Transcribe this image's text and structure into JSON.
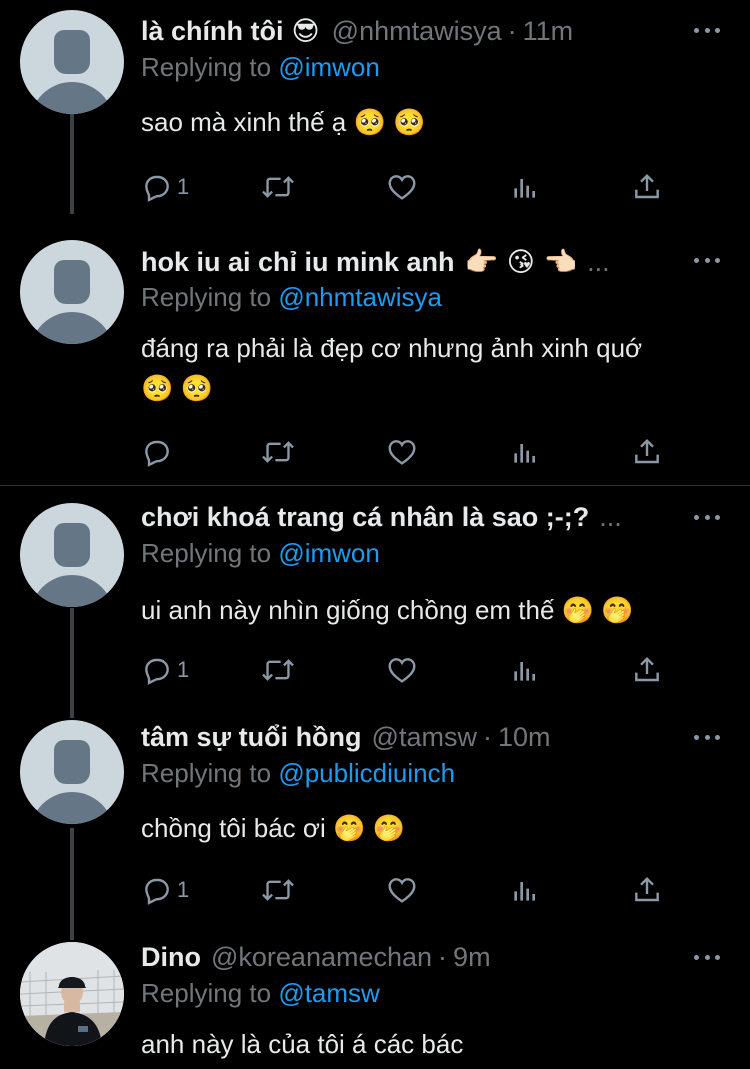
{
  "tweets": [
    {
      "name": "là chính tôi",
      "name_emoji": "😎",
      "handle": "@nhmtawisya",
      "dot": "·",
      "time": "11m",
      "truncated": "",
      "replying_prefix": "Replying to ",
      "replying_to": "@imwon",
      "text_lines": [
        "sao mà xinh thế ạ 🥺 🥺"
      ],
      "reply_count": "1",
      "retweet_count": "",
      "like_count": ""
    },
    {
      "name": "hok iu ai chỉ iu mink anh",
      "name_emoji": "👉🏻 😘 👈🏻",
      "handle": "",
      "dot": "",
      "time": "",
      "truncated": "...",
      "replying_prefix": "Replying to ",
      "replying_to": "@nhmtawisya",
      "text_lines": [
        "đáng ra phải là đẹp cơ nhưng ảnh xinh quớ",
        "🥺 🥺"
      ],
      "reply_count": "",
      "retweet_count": "",
      "like_count": ""
    },
    {
      "name": "chơi khoá trang cá nhân là sao ;-;?",
      "name_emoji": "",
      "handle": "",
      "dot": "",
      "time": "",
      "truncated": "...",
      "replying_prefix": "Replying to ",
      "replying_to": "@imwon",
      "text_lines": [
        "ui anh này nhìn giống chồng em thế 🤭 🤭"
      ],
      "reply_count": "1",
      "retweet_count": "",
      "like_count": ""
    },
    {
      "name": "tâm sự tuổi hồng",
      "name_emoji": "",
      "handle": "@tamsw",
      "dot": "·",
      "time": "10m",
      "truncated": "",
      "replying_prefix": "Replying to ",
      "replying_to": "@publicdiuinch",
      "text_lines": [
        "chồng tôi bác ơi 🤭 🤭"
      ],
      "reply_count": "1",
      "retweet_count": "",
      "like_count": ""
    },
    {
      "name": "Dino",
      "name_emoji": "",
      "handle": "@koreanamechan",
      "dot": "·",
      "time": "9m",
      "truncated": "",
      "replying_prefix": "Replying to ",
      "replying_to": "@tamsw",
      "text_lines": [
        "anh này là của tôi á các bác"
      ],
      "reply_count": "",
      "retweet_count": "",
      "like_count": ""
    }
  ],
  "icons": {
    "reply": "reply-icon",
    "retweet": "retweet-icon",
    "like": "heart-icon",
    "views": "analytics-icon",
    "share": "share-icon",
    "more": "more-dots-icon"
  },
  "colors": {
    "background": "#000000",
    "text": "#e7e9ea",
    "muted": "#71767b",
    "mention": "#1d9bf0",
    "icon": "#8b98a5"
  }
}
